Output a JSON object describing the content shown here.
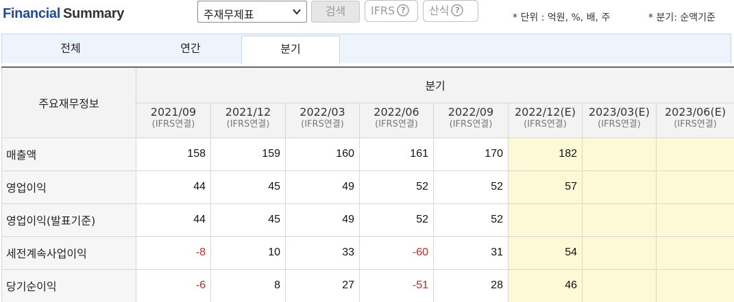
{
  "header": {
    "title_part1": "Financial",
    "title_part2": "Summary",
    "select_value": "주재무제표",
    "search_label": "검색",
    "ifrs_label": "IFRS",
    "calc_label": "산식",
    "help_glyph": "?",
    "unit_note": "* 단위 : 억원, %, 배, 주",
    "quarter_note": "* 분기: 순액기준"
  },
  "tabs": [
    {
      "label": "전체"
    },
    {
      "label": "연간"
    },
    {
      "label": "분기"
    }
  ],
  "table": {
    "row_header": "주요재무정보",
    "section_header": "분기",
    "columns": [
      {
        "period": "2021/09",
        "basis": "(IFRS연결)",
        "estimate": false
      },
      {
        "period": "2021/12",
        "basis": "(IFRS연결)",
        "estimate": false
      },
      {
        "period": "2022/03",
        "basis": "(IFRS연결)",
        "estimate": false
      },
      {
        "period": "2022/06",
        "basis": "(IFRS연결)",
        "estimate": false
      },
      {
        "period": "2022/09",
        "basis": "(IFRS연결)",
        "estimate": false
      },
      {
        "period": "2022/12(E)",
        "basis": "(IFRS연결)",
        "estimate": true
      },
      {
        "period": "2023/03(E)",
        "basis": "(IFRS연결)",
        "estimate": true
      },
      {
        "period": "2023/06(E)",
        "basis": "(IFRS연결)",
        "estimate": true
      }
    ],
    "rows": [
      {
        "label": "매출액",
        "values": [
          "158",
          "159",
          "160",
          "161",
          "170",
          "182",
          "",
          ""
        ]
      },
      {
        "label": "영업이익",
        "values": [
          "44",
          "45",
          "49",
          "52",
          "52",
          "57",
          "",
          ""
        ]
      },
      {
        "label": "영업이익(발표기준)",
        "values": [
          "44",
          "45",
          "49",
          "52",
          "52",
          "",
          "",
          ""
        ]
      },
      {
        "label": "세전계속사업이익",
        "values": [
          "-8",
          "10",
          "33",
          "-60",
          "31",
          "54",
          "",
          ""
        ]
      },
      {
        "label": "당기순이익",
        "values": [
          "-6",
          "8",
          "27",
          "-51",
          "28",
          "46",
          "",
          ""
        ]
      }
    ]
  },
  "colors": {
    "brand_blue": "#1e4b9a",
    "negative_red": "#b42c2c",
    "estimate_bg": "#fdf8d5",
    "tab_bg": "#eef4fb"
  }
}
